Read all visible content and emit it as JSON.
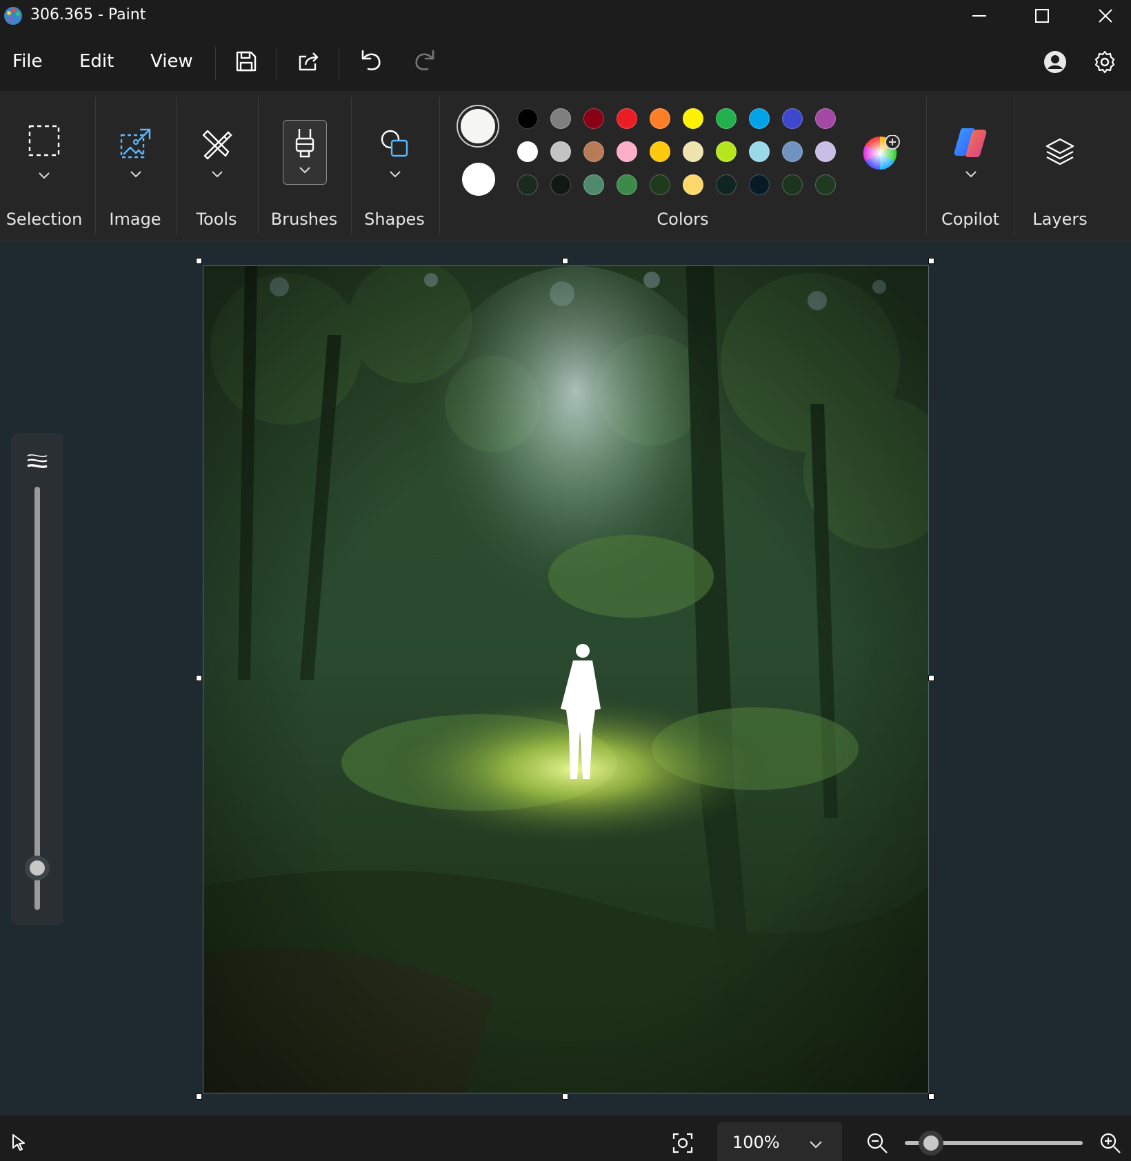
{
  "window": {
    "title": "306.365 - Paint"
  },
  "menu": {
    "file": "File",
    "edit": "Edit",
    "view": "View"
  },
  "ribbon": {
    "groups": {
      "selection": "Selection",
      "image": "Image",
      "tools": "Tools",
      "brushes": "Brushes",
      "shapes": "Shapes",
      "colors": "Colors",
      "copilot": "Copilot",
      "layers": "Layers"
    },
    "primary_color": "#f5f5f3",
    "secondary_color": "#ffffff",
    "palette_rows": [
      [
        "#000000",
        "#7f7f7f",
        "#880015",
        "#ed1c24",
        "#ff7f27",
        "#fff200",
        "#22b14c",
        "#00a2e8",
        "#3f48cc",
        "#a349a4"
      ],
      [
        "#ffffff",
        "#c3c3c3",
        "#b97a57",
        "#ffaec9",
        "#ffc90e",
        "#efe4b0",
        "#b5e61d",
        "#99d9ea",
        "#7092be",
        "#c8bfe7"
      ],
      [
        "#1b2a1e",
        "#121812",
        "#4f8a6c",
        "#3d8a4a",
        "#1f3a1d",
        "#ffd86b",
        "#102420",
        "#071a26",
        "#1b351c",
        "#203a22"
      ]
    ]
  },
  "status": {
    "zoom": "100%"
  },
  "icons": {
    "app": "paint-palette-icon",
    "minimize": "minimize-icon",
    "maximize": "maximize-icon",
    "close": "close-icon",
    "save": "save-icon",
    "share": "share-icon",
    "undo": "undo-icon",
    "redo": "redo-icon",
    "account": "account-icon",
    "settings": "gear-icon",
    "cursor": "pointer-icon",
    "fit": "fit-to-window-icon",
    "zoom_out": "zoom-out-icon",
    "zoom_in": "zoom-in-icon"
  }
}
